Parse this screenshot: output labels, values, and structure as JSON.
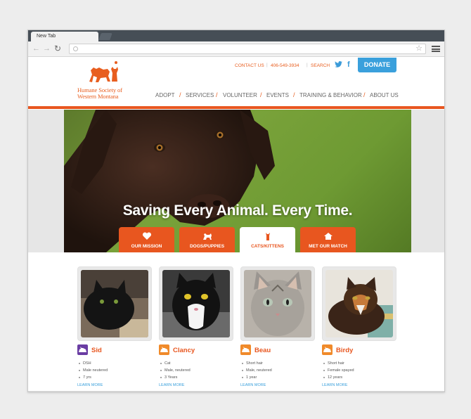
{
  "browser": {
    "tab_title": "New Tab",
    "back": "←",
    "forward": "→",
    "reload": "↻",
    "url": "",
    "star": "☆"
  },
  "site": {
    "logo_line1": "Humane Society of",
    "logo_line2": "Western Montana",
    "utility": {
      "contact": "CONTACT US",
      "phone": "406-549-3934",
      "search": "SEARCH",
      "separator": "|",
      "facebook_glyph": "f"
    },
    "donate": "DONATE",
    "nav": {
      "separator": "/",
      "items": [
        "ADOPT",
        "SERVICES",
        "VOLUNTEER",
        "EVENTS",
        "TRAINING & BEHAVIOR",
        "ABOUT US"
      ]
    },
    "hero_title": "Saving Every Animal. Every Time.",
    "hero_tabs": [
      "OUR MISSION",
      "DOGS/PUPPIES",
      "CATS/KITTENS",
      "MET OUR MATCH"
    ],
    "active_tab_index": 2,
    "cards": [
      {
        "name": "Sid",
        "badge_color": "#6a3da3",
        "attributes": [
          "DSH",
          "Male neutered",
          "7 yrs"
        ],
        "link": "LEARN MORE"
      },
      {
        "name": "Clancy",
        "badge_color": "#f08a2a",
        "attributes": [
          "Cat",
          "Male, neutered",
          "3 Years"
        ],
        "link": "LEARN MORE"
      },
      {
        "name": "Beau",
        "badge_color": "#f08a2a",
        "attributes": [
          "Short hair",
          "Male, neutered",
          "1 year"
        ],
        "link": "LEARN MORE"
      },
      {
        "name": "Birdy",
        "badge_color": "#f08a2a",
        "attributes": [
          "Short hair",
          "Female spayed",
          "12 years"
        ],
        "link": "LEARN MORE"
      }
    ]
  },
  "colors": {
    "brand_orange": "#e8561f",
    "donate_blue": "#3aa0dc"
  }
}
